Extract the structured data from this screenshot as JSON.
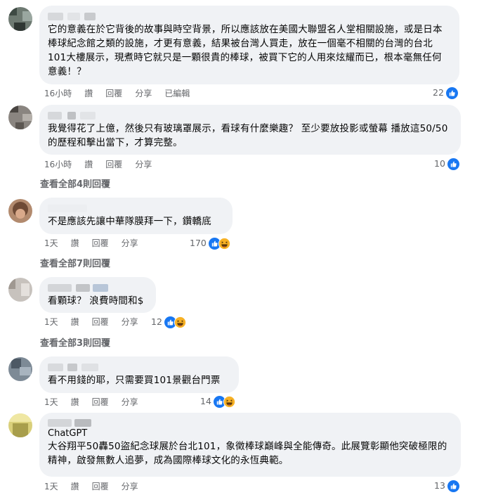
{
  "comments": [
    {
      "text": "它的意義在於它背後的故事與時空背景，所以應該放在美國大聯盟名人堂相關設施，或是日本棒球紀念館之類的設施，才更有意義，結果被台灣人買走，放在一個毫不相關的台灣的台北101大樓展示，現煮時它就只是一顆很貴的棒球，被買下它的人用來炫耀而已，根本毫無任何意義！？",
      "time": "16小時",
      "like": "讚",
      "reply": "回覆",
      "share": "分享",
      "edited": "已編輯",
      "reaction_count": "22",
      "reactions": [
        "like"
      ]
    },
    {
      "text": "我覺得花了上億，然後只有玻璃罩展示，看球有什麼樂趣？ 至少要放投影或螢幕 播放這50/50的歷程和擊出當下，才算完整。",
      "time": "16小時",
      "like": "讚",
      "reply": "回覆",
      "share": "分享",
      "reaction_count": "10",
      "reactions": [
        "like"
      ],
      "view_replies": "查看全部4則回覆"
    },
    {
      "text": "不是應該先讓中華隊膜拜一下，鑽轎底",
      "time": "1天",
      "like": "讚",
      "reply": "回覆",
      "share": "分享",
      "reaction_count": "170",
      "reactions": [
        "like",
        "haha"
      ],
      "view_replies": "查看全部7則回覆"
    },
    {
      "text": "看顆球？ 浪費時間和$",
      "time": "1天",
      "like": "讚",
      "reply": "回覆",
      "share": "分享",
      "reaction_count": "12",
      "reactions": [
        "like",
        "haha"
      ],
      "view_replies": "查看全部3則回覆"
    },
    {
      "text": "看不用錢的耶，只需要買101景觀台門票",
      "time": "1天",
      "like": "讚",
      "reply": "回覆",
      "share": "分享",
      "reaction_count": "14",
      "reactions": [
        "like",
        "haha"
      ]
    },
    {
      "author_tag": "ChatGPT",
      "text": "大谷翔平50轟50盜紀念球展於台北101，象徵棒球巔峰與全能傳奇。此展覽彰顯他突破極限的精神，啟發無數人追夢，成為國際棒球文化的永恆典範。",
      "time": "1天",
      "like": "讚",
      "reply": "回覆",
      "share": "分享",
      "reaction_count": "13",
      "reactions": [
        "like"
      ]
    }
  ],
  "colors": {
    "bubble": "#f0f2f5",
    "meta": "#65676b",
    "like_blue": "#1877f2",
    "haha_yellow": "#f7b125"
  },
  "icons": [
    "like-icon",
    "haha-icon"
  ]
}
